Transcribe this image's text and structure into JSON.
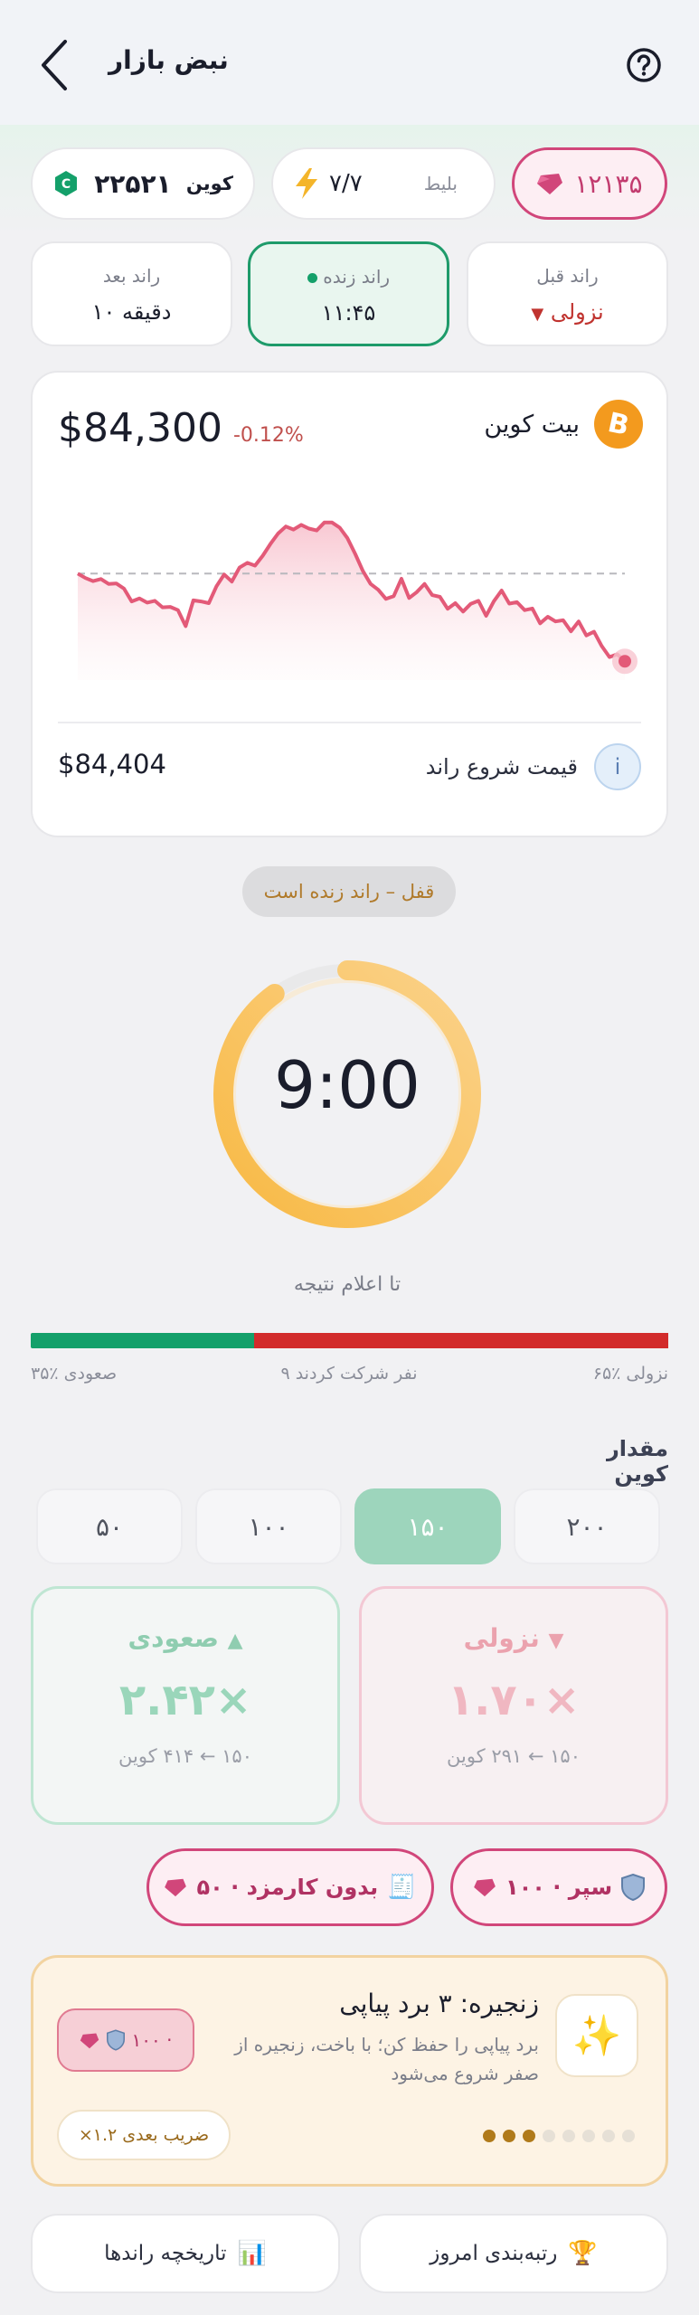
{
  "header": {
    "title": "نبض بازار"
  },
  "stats": {
    "gems": "۱۲۱۳۵",
    "ticket_label": "بلیط",
    "ticket_value": "۷/۷",
    "coin_label": "کوین",
    "coin_value": "۲۲۵۲۱"
  },
  "rounds": {
    "previous_label": "راند قبل",
    "previous_value": "نزولی",
    "live_label": "راند زنده",
    "live_value": "۱۱:۴۵",
    "next_label": "راند بعد",
    "next_value": "۱۰ دقیقه"
  },
  "market": {
    "asset_name": "بیت کوین",
    "price": "$84,300",
    "change": "-0.12%",
    "start_price_label": "قیمت شروع راند",
    "start_price": "$84,404",
    "info_glyph": "i"
  },
  "chart_data": {
    "type": "line",
    "series": [
      {
        "values": [
          84404,
          84385,
          84372,
          84381,
          84360,
          84362,
          84340,
          84285,
          84298,
          84280,
          84288,
          84260,
          84262,
          84248,
          84180,
          84290,
          84285,
          84278,
          84350,
          84400,
          84370,
          84430,
          84450,
          84438,
          84480,
          84530,
          84575,
          84605,
          84592,
          84612,
          84596,
          84588,
          84622,
          84622,
          84600,
          84555,
          84488,
          84415,
          84360,
          84335,
          84296,
          84308,
          84382,
          84300,
          84325,
          84360,
          84312,
          84305,
          84254,
          84278,
          84242,
          84275,
          84288,
          84224,
          84286,
          84332,
          84276,
          84282,
          84248,
          84255,
          84192,
          84220,
          84200,
          84205,
          84158,
          84200,
          84140,
          84156,
          84095,
          84048,
          84060,
          84030
        ]
      }
    ],
    "baseline": 84404,
    "ylim": [
      83950,
      84760
    ],
    "grid": false,
    "colors": {
      "line": "#e35a78",
      "fill_top": "#f8c5d0",
      "baseline": "#b8b8bd"
    }
  },
  "lock": {
    "label": "قفل – راند زنده است"
  },
  "timer": {
    "value": "9:00",
    "caption": "تا اعلام نتیجه",
    "progress": 0.9
  },
  "split": {
    "up_fraction": 0.35,
    "up_label": "۳۵٪ صعودی",
    "participants": "۹ نفر شرکت کردند",
    "down_label": "۶۵٪ نزولی"
  },
  "amount": {
    "title": "مقدار کوین",
    "options": [
      "۵۰",
      "۱۰۰",
      "۱۵۰",
      "۲۰۰"
    ],
    "selected_index": 2
  },
  "bets": {
    "up": {
      "title": "صعودی",
      "multiplier": "۲.۴۲×",
      "payout": "۱۵۰ ← ۴۱۴ کوین"
    },
    "down": {
      "title": "نزولی",
      "multiplier": "۱.۷۰×",
      "payout": "۱۵۰ ← ۲۹۱ کوین"
    }
  },
  "powerups": {
    "shield_label": "سپر · ۱۰۰",
    "nofee_label": "بدون کارمزد · ۵۰"
  },
  "streak": {
    "title": "زنجیره: ۳ برد پیاپی",
    "description_line1": "برد پیاپی را حفظ کن؛ با باخت، زنجیره از",
    "description_line2": "صفر شروع می‌شود",
    "protect_price": "۱۰۰ ·",
    "next_multiplier": "ضریب بعدی ۱.۲×",
    "dots_filled": 3,
    "dots_total": 8
  },
  "bottom": {
    "leaderboard": "رتبه‌بندی امروز",
    "history": "تاریخچه راندها"
  },
  "colors": {
    "accent_green": "#14a06a",
    "accent_red": "#d22b2b",
    "gem_pink": "#d1467a",
    "timer_orange": "#f8b944"
  }
}
